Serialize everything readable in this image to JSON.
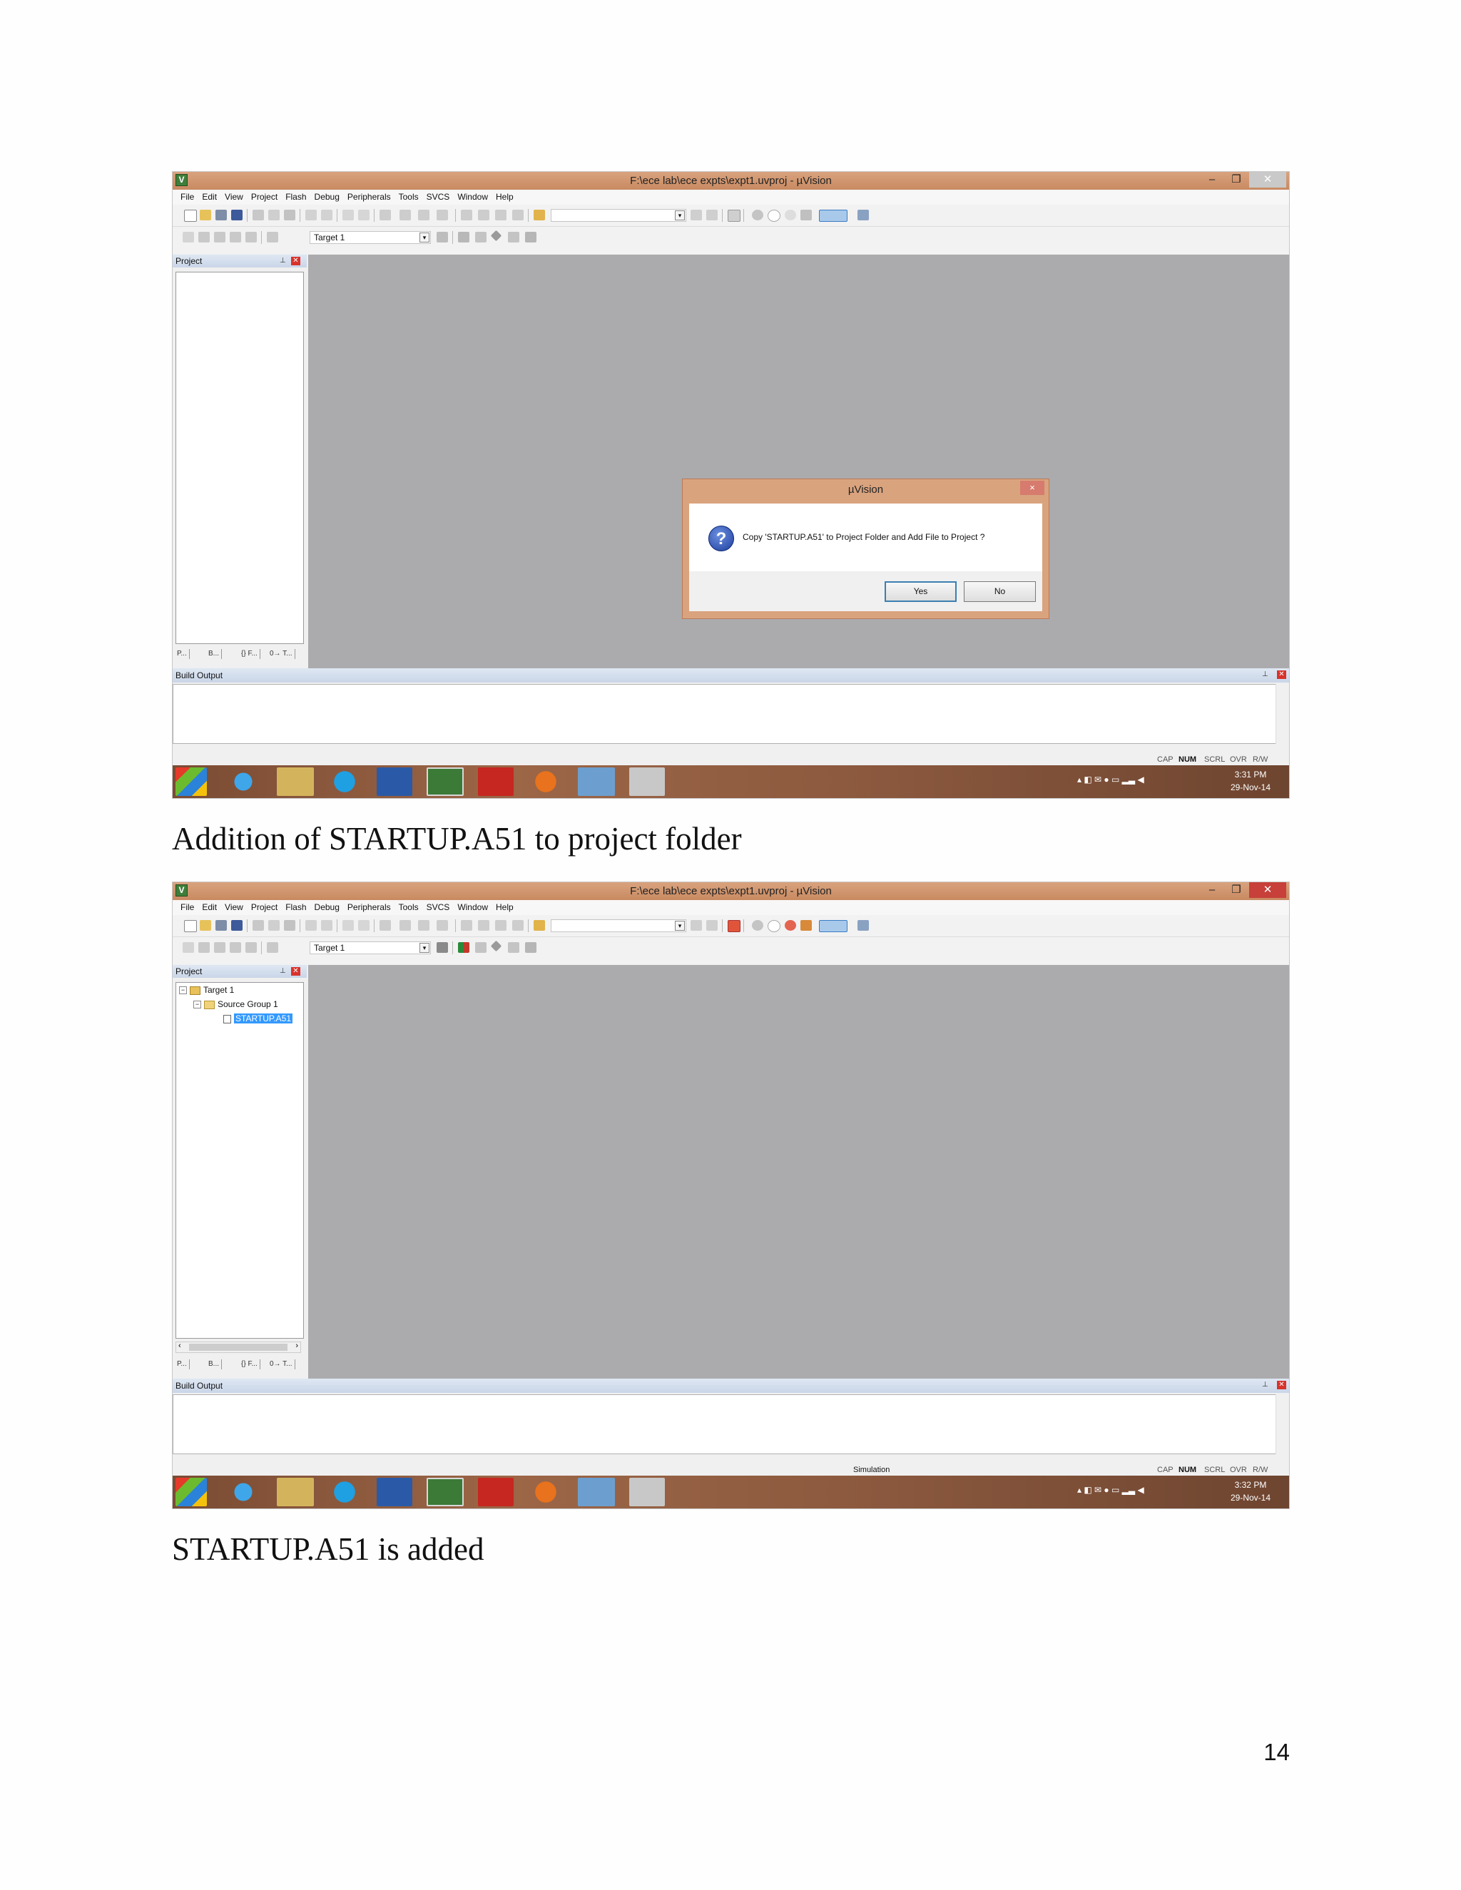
{
  "screenshot1": {
    "window_title": "F:\\ece lab\\ece expts\\expt1.uvproj - µVision",
    "menu": [
      "File",
      "Edit",
      "View",
      "Project",
      "Flash",
      "Debug",
      "Peripherals",
      "Tools",
      "SVCS",
      "Window",
      "Help"
    ],
    "target_combo": "Target 1",
    "project_pane_title": "Project",
    "project_tabs": [
      "P...",
      "B...",
      "{} F...",
      "0→ T..."
    ],
    "build_output_title": "Build Output",
    "dialog": {
      "title": "µVision",
      "close": "×",
      "message": "Copy 'STARTUP.A51' to Project Folder and Add File to Project ?",
      "yes": "Yes",
      "no": "No"
    },
    "status": [
      "CAP",
      "NUM",
      "SCRL",
      "OVR",
      "R/W"
    ],
    "clock_time": "3:31 PM",
    "clock_date": "29-Nov-14"
  },
  "caption1": "Addition of STARTUP.A51 to project folder",
  "screenshot2": {
    "window_title": "F:\\ece lab\\ece expts\\expt1.uvproj - µVision",
    "menu": [
      "File",
      "Edit",
      "View",
      "Project",
      "Flash",
      "Debug",
      "Peripherals",
      "Tools",
      "SVCS",
      "Window",
      "Help"
    ],
    "target_combo": "Target 1",
    "project_pane_title": "Project",
    "tree": {
      "target": "Target 1",
      "group": "Source Group 1",
      "file": "STARTUP.A51"
    },
    "project_tabs": [
      "P...",
      "B...",
      "{} F...",
      "0→ T..."
    ],
    "build_output_title": "Build Output",
    "status_mode": "Simulation",
    "status": [
      "CAP",
      "NUM",
      "SCRL",
      "OVR",
      "R/W"
    ],
    "clock_time": "3:32 PM",
    "clock_date": "29-Nov-14"
  },
  "caption2": "STARTUP.A51 is added",
  "page_number": "14"
}
